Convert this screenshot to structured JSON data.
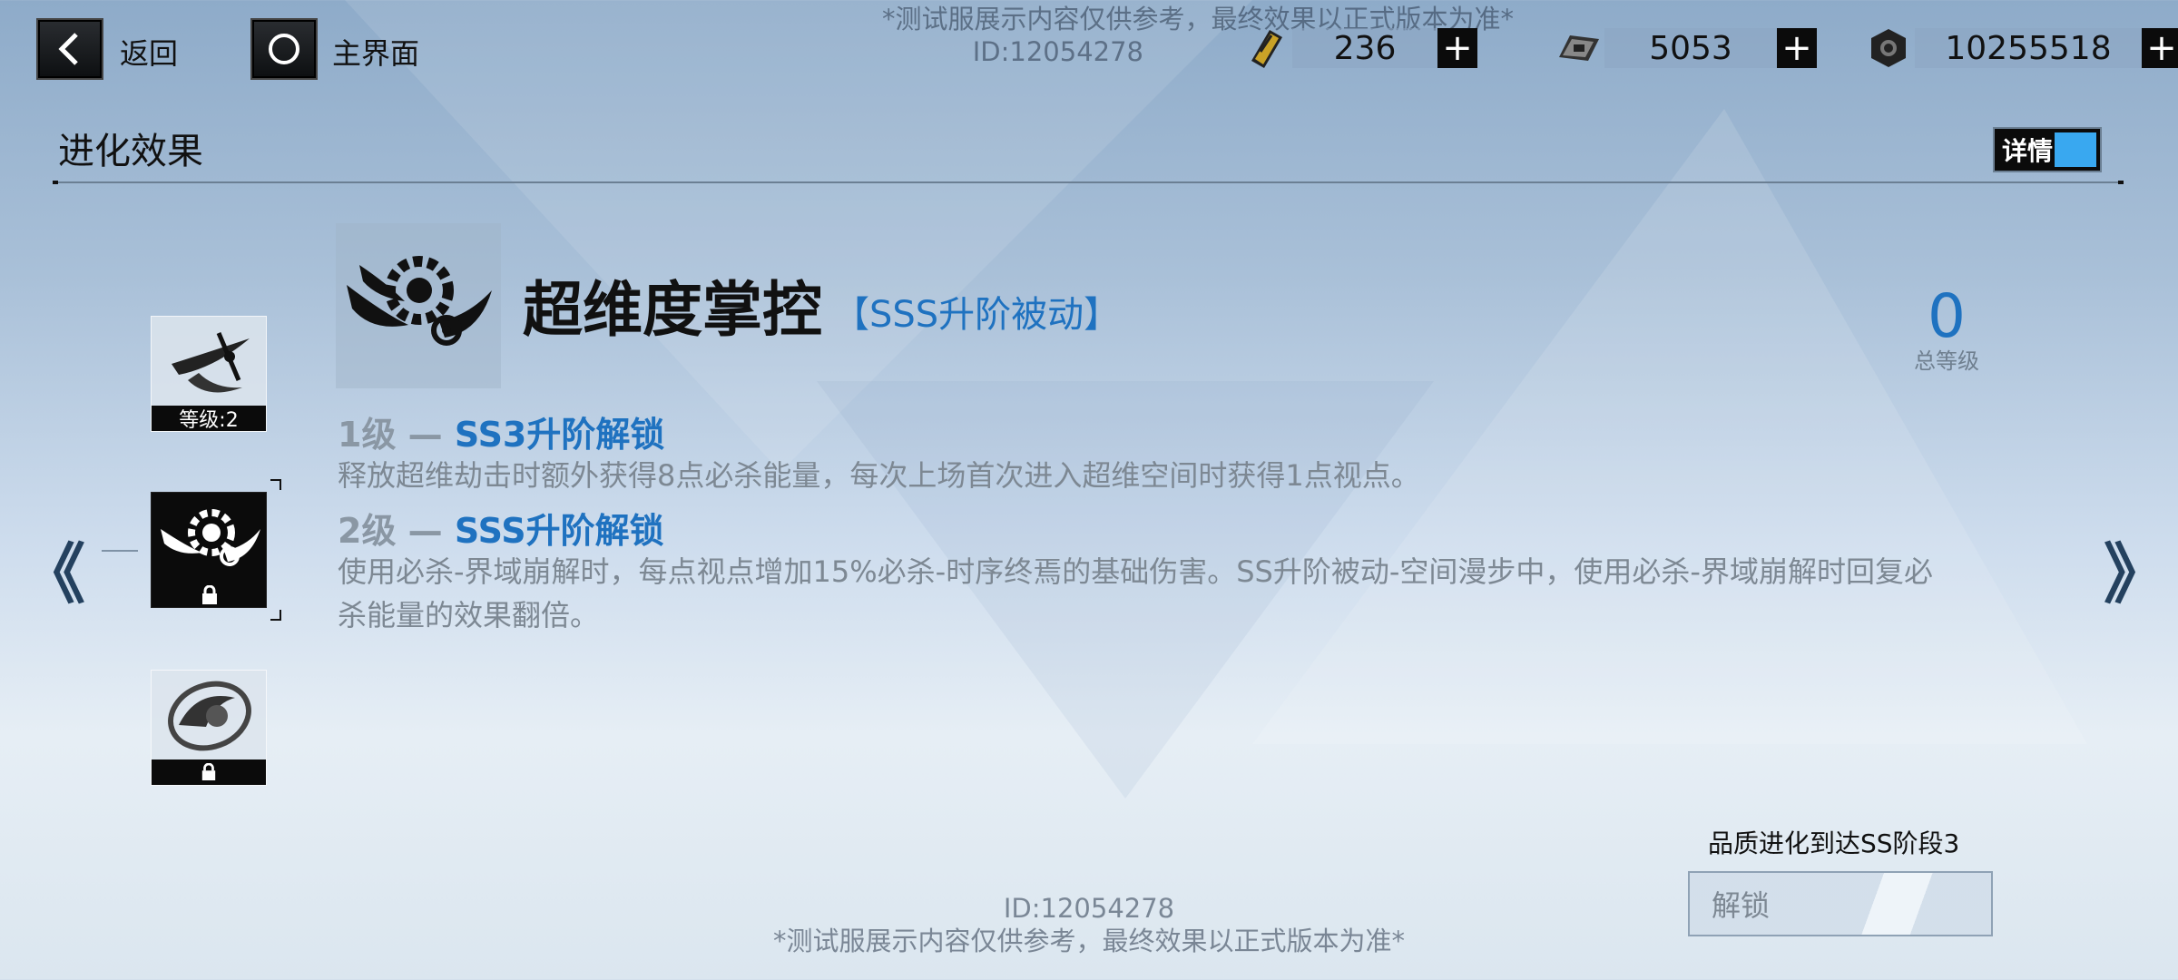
{
  "watermark": {
    "notice": "*测试服展示内容仅供参考，最终效果以正式版本为准*",
    "id": "ID:12054278"
  },
  "nav": {
    "back_label": "返回",
    "home_label": "主界面"
  },
  "currencies": [
    {
      "icon": "gold-ticket-icon",
      "value": "236"
    },
    {
      "icon": "chip-icon",
      "value": "5053"
    },
    {
      "icon": "hex-nut-icon",
      "value": "10255518"
    }
  ],
  "section": {
    "title": "进化效果",
    "detail_label": "详情"
  },
  "skill_list": [
    {
      "icon": "slash-skill-icon",
      "caption": "等级:2",
      "locked": false
    },
    {
      "icon": "gear-wing-skill-icon",
      "caption": "",
      "locked": true,
      "selected": true
    },
    {
      "icon": "vortex-skill-icon",
      "caption": "",
      "locked": true
    }
  ],
  "skill": {
    "name": "超维度掌控",
    "tag": "【SSS升阶被动】",
    "total_level_value": "0",
    "total_level_label": "总等级"
  },
  "levels": [
    {
      "num": "1级 — ",
      "name": "SS3升阶解锁",
      "desc": "释放超维劫击时额外获得8点必杀能量，每次上场首次进入超维空间时获得1点视点。"
    },
    {
      "num": "2级 — ",
      "name": "SSS升阶解锁",
      "desc": "使用必杀-界域崩解时，每点视点增加15%必杀-时序终焉的基础伤害。SS升阶被动-空间漫步中，使用必杀-界域崩解时回复必杀能量的效果翻倍。"
    }
  ],
  "unlock": {
    "requirement": "品质进化到达SS阶段3",
    "button_label": "解锁"
  },
  "arrows": {
    "left": "《",
    "right": "》"
  },
  "colors": {
    "accent": "#1f72c0",
    "toggle": "#39a8f0"
  }
}
